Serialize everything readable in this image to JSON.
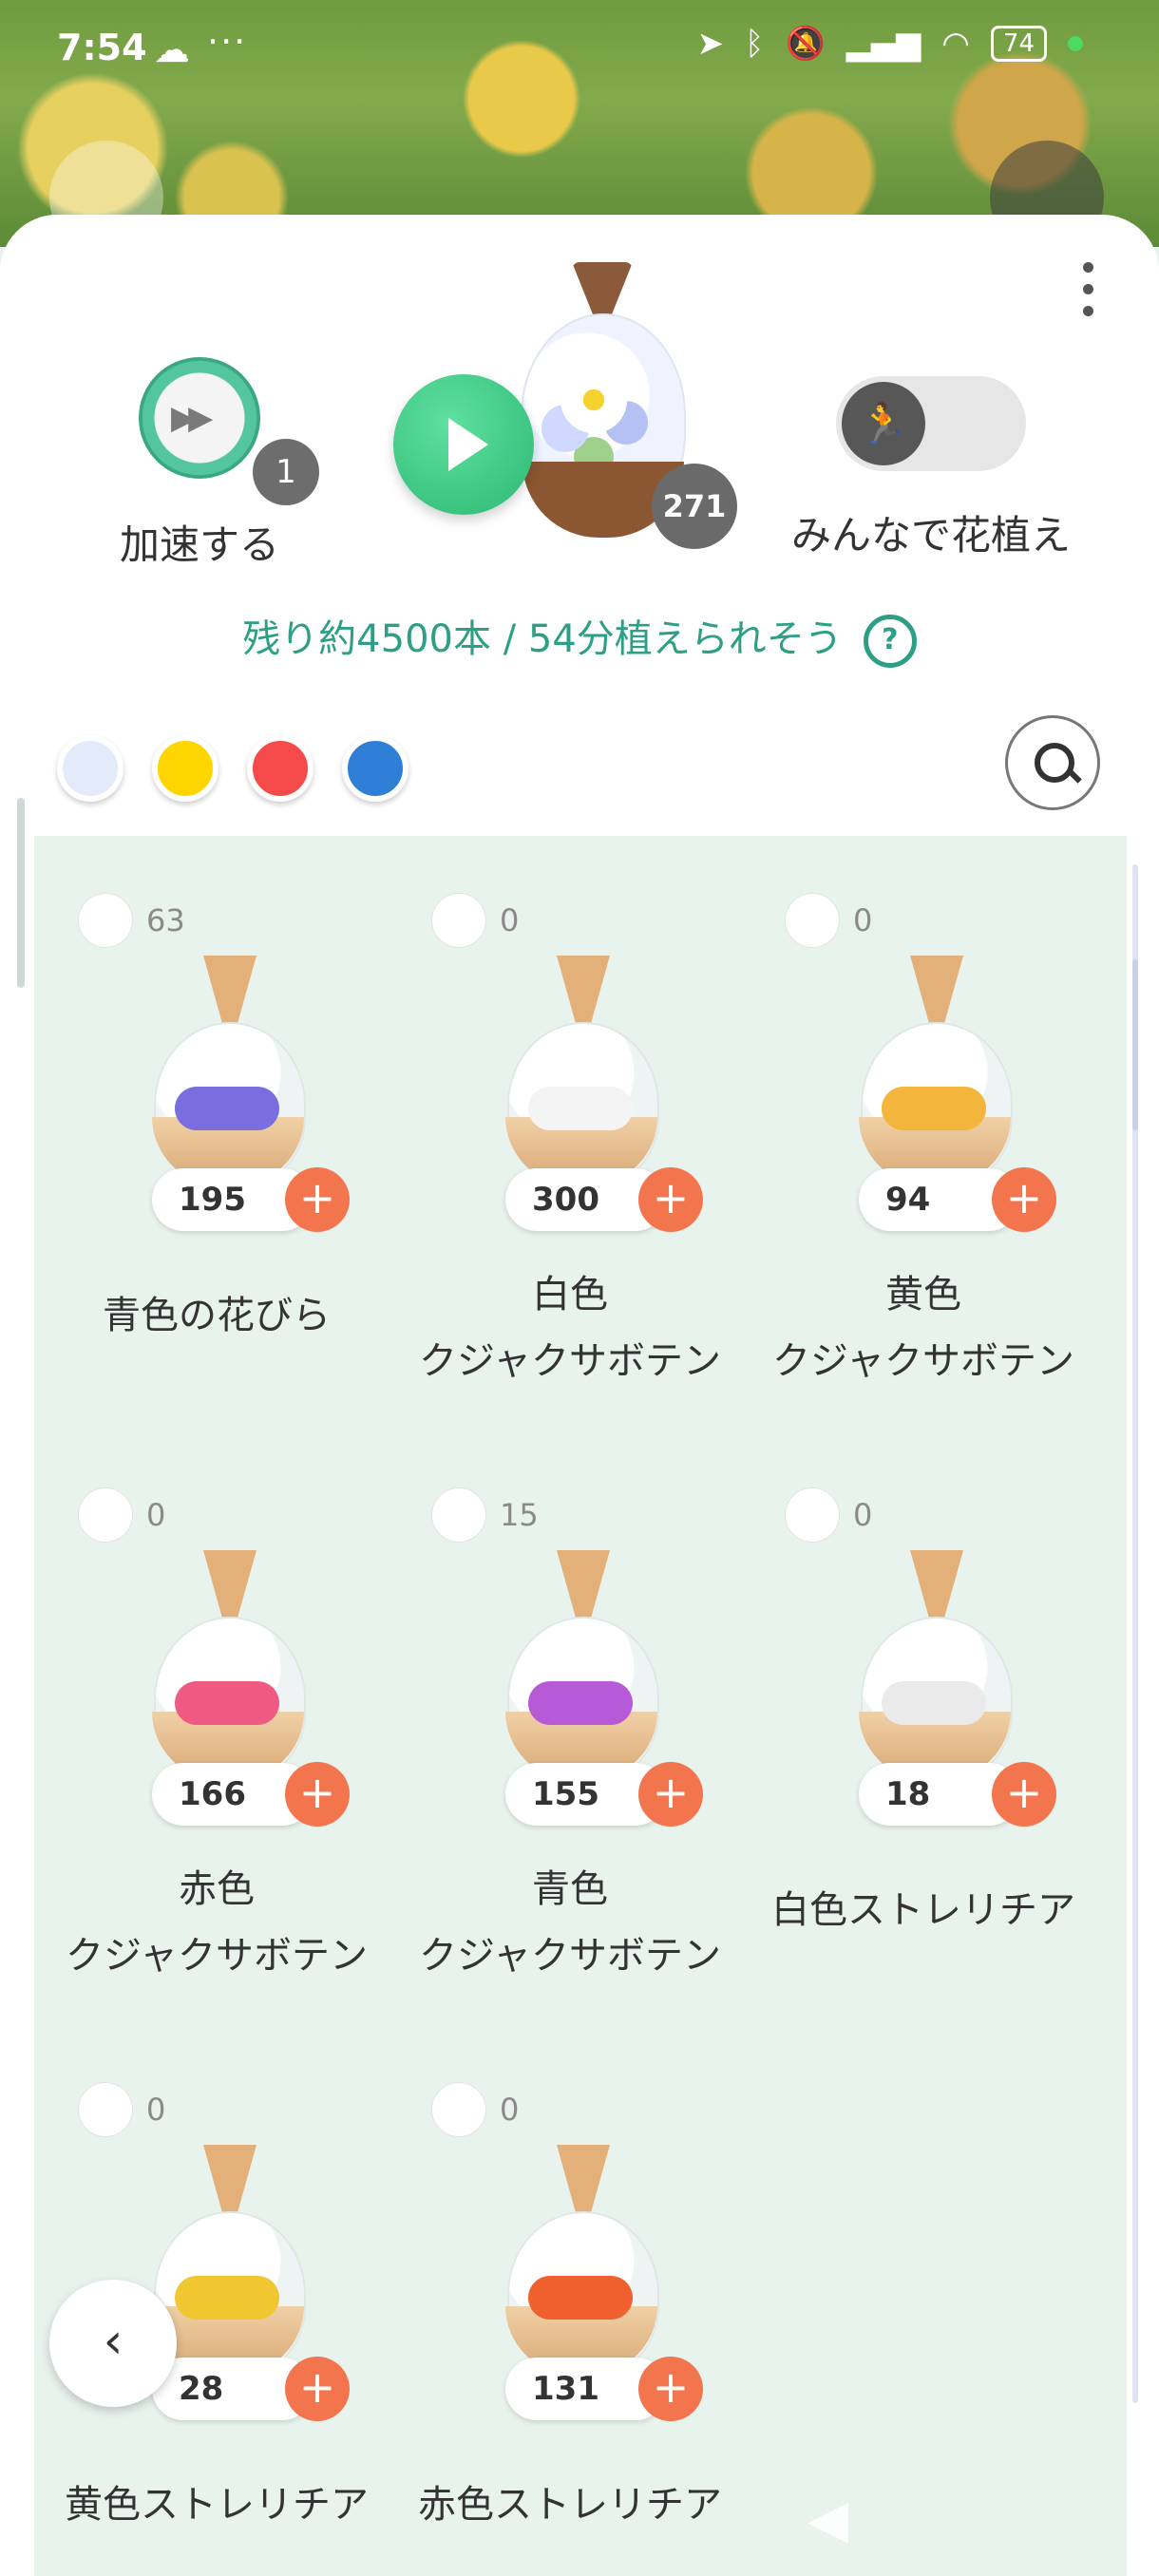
{
  "status_bar": {
    "time": "7:54",
    "battery": "74"
  },
  "header": {
    "accelerate_label": "加速する",
    "accelerate_count": "1",
    "pot_count": "271",
    "plant_together_label": "みんなで花植え",
    "remaining_text": "残り約4500本 / 54分植えられそう",
    "help_icon": "?"
  },
  "filters": [
    {
      "name": "white",
      "color": "#e3ebfb"
    },
    {
      "name": "yellow",
      "color": "#ffd500"
    },
    {
      "name": "red",
      "color": "#f64a4a"
    },
    {
      "name": "blue",
      "color": "#2f7fd6"
    }
  ],
  "items": [
    {
      "owned": "63",
      "qty": "195",
      "name_line1": "青色の花びら",
      "name_line2": "",
      "bloom": "#7a6de0"
    },
    {
      "owned": "0",
      "qty": "300",
      "name_line1": "白色",
      "name_line2": "クジャクサボテン",
      "bloom": "#f4f4f4"
    },
    {
      "owned": "0",
      "qty": "94",
      "name_line1": "黄色",
      "name_line2": "クジャクサボテン",
      "bloom": "#f3b53b"
    },
    {
      "owned": "0",
      "qty": "166",
      "name_line1": "赤色",
      "name_line2": "クジャクサボテン",
      "bloom": "#ef5a82"
    },
    {
      "owned": "15",
      "qty": "155",
      "name_line1": "青色",
      "name_line2": "クジャクサボテン",
      "bloom": "#b65ad8"
    },
    {
      "owned": "0",
      "qty": "18",
      "name_line1": "白色ストレリチア",
      "name_line2": "",
      "bloom": "#eaeaea"
    },
    {
      "owned": "0",
      "qty": "28",
      "name_line1": "黄色ストレリチア",
      "name_line2": "",
      "bloom": "#f0c730"
    },
    {
      "owned": "0",
      "qty": "131",
      "name_line1": "赤色ストレリチア",
      "name_line2": "",
      "bloom": "#f0602e"
    }
  ],
  "plus_label": "+",
  "back_icon": "‹"
}
